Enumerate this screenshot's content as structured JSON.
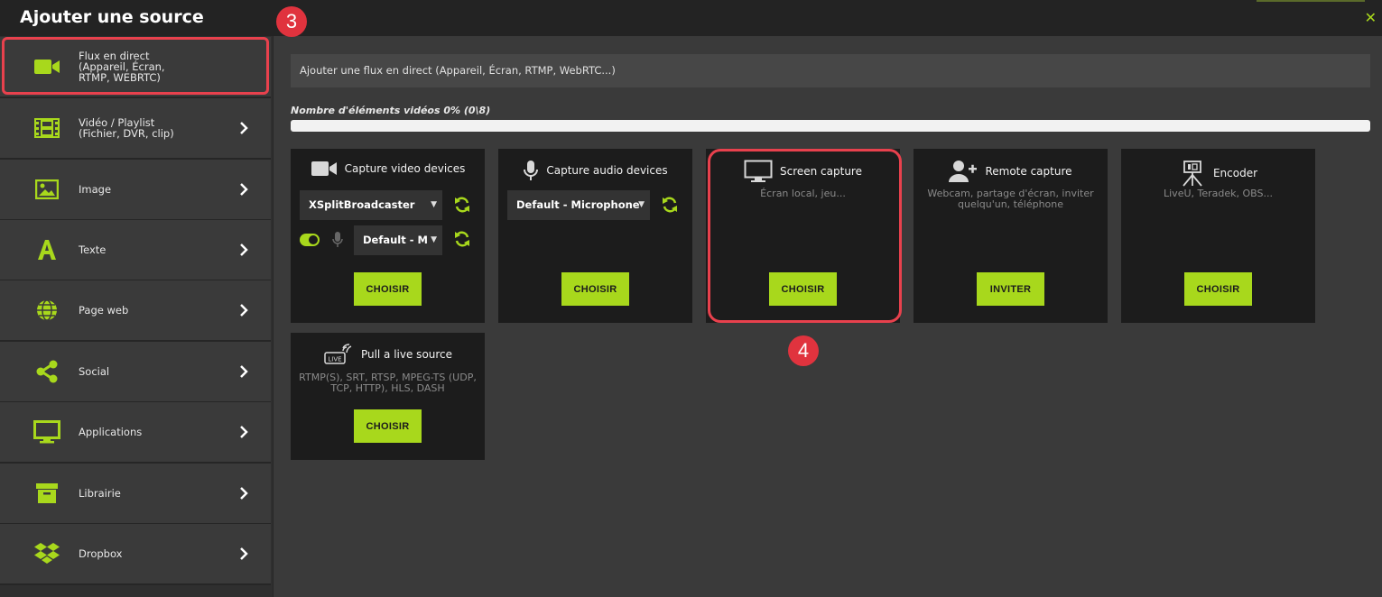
{
  "dialog": {
    "title": "Ajouter une source"
  },
  "sidebar": {
    "items": [
      {
        "label": "Flux en direct\n(Appareil, Écran,\nRTMP, WEBRTC)"
      },
      {
        "label": "Vidéo / Playlist\n(Fichier, DVR, clip)"
      },
      {
        "label": "Image"
      },
      {
        "label": "Texte"
      },
      {
        "label": "Page web"
      },
      {
        "label": "Social"
      },
      {
        "label": "Applications"
      },
      {
        "label": "Librairie"
      },
      {
        "label": "Dropbox"
      }
    ]
  },
  "main": {
    "description": "Ajouter une flux en direct (Appareil, Écran, RTMP, WebRTC...)",
    "count_label": "Nombre d'éléments vidéos 0% (0\\8)",
    "progress_percent": 0
  },
  "cards": {
    "video": {
      "title": "Capture video devices",
      "device": "XSplitBroadcaster",
      "audio": "Default - M",
      "button": "CHOISIR"
    },
    "audio": {
      "title": "Capture audio devices",
      "device": "Default - Microphone",
      "button": "CHOISIR"
    },
    "screen": {
      "title": "Screen capture",
      "desc": "Écran local, jeu...",
      "button": "CHOISIR"
    },
    "remote": {
      "title": "Remote capture",
      "desc": "Webcam, partage d'écran, inviter quelqu'un, téléphone",
      "button": "INVITER"
    },
    "encoder": {
      "title": "Encoder",
      "desc": "LiveU, Teradek, OBS...",
      "button": "CHOISIR"
    },
    "pull": {
      "title": "Pull a live source",
      "desc": "RTMP(S), SRT, RTSP, MPEG-TS (UDP, TCP, HTTP), HLS, DASH",
      "button": "CHOISIR"
    }
  },
  "annotations": {
    "step3": "3",
    "step4": "4"
  },
  "colors": {
    "accent": "#a8d81c",
    "highlight": "#e8414d",
    "card_bg": "#1c1c1c"
  }
}
